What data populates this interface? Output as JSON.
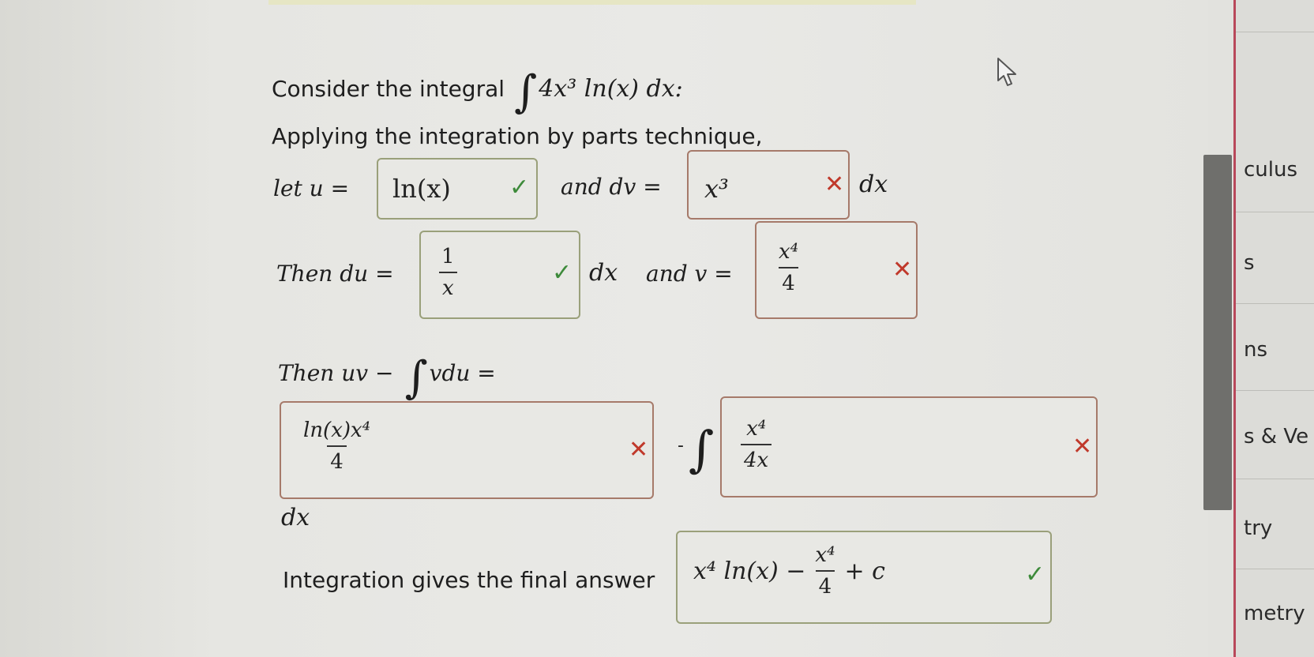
{
  "question": {
    "consider_text": "Consider the integral",
    "integral_expr": "4x³ ln(x) dx:",
    "applying_text": "Applying the integration by parts technique,",
    "let_u_label": "let u =",
    "and_dv_label": "and dv =",
    "dx_suffix": "dx",
    "then_du_label": "Then du =",
    "and_v_label": "and v =",
    "then_uv_label": "Then uv −",
    "vdu_text": "vdu =",
    "minus_text": "-",
    "final_text": "Integration gives the final answer"
  },
  "answers": {
    "u": {
      "value": "ln(x)",
      "status": "correct"
    },
    "dv": {
      "value": "x³",
      "status": "incorrect"
    },
    "du": {
      "num": "1",
      "den": "x",
      "status": "correct"
    },
    "v": {
      "num": "x⁴",
      "den": "4",
      "status": "incorrect"
    },
    "uv": {
      "num": "ln(x)x⁴",
      "den": "4",
      "status": "incorrect"
    },
    "integrand": {
      "num": "x⁴",
      "den": "4x",
      "status": "incorrect"
    },
    "final": {
      "lead": "x⁴ ln(x) −",
      "num": "x⁴",
      "den": "4",
      "tail": "+ c",
      "status": "correct"
    }
  },
  "sidebar": {
    "items": [
      "culus",
      "s",
      "ns",
      "s & Ve",
      "try",
      "metry"
    ]
  },
  "colors": {
    "correct": "#3d8a3a",
    "incorrect": "#c0392b",
    "accent_sidebar": "#b8485a"
  }
}
